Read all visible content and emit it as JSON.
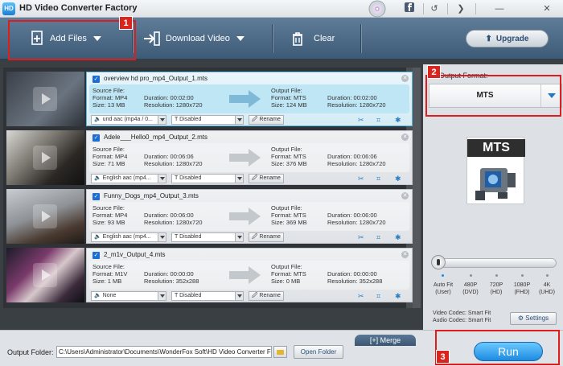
{
  "window": {
    "title": "HD Video Converter Factory",
    "logo_text": "HD"
  },
  "titlebar_icons": [
    "facebook-icon",
    "refresh-icon",
    "twitter-icon",
    "minimize-icon",
    "close-icon"
  ],
  "toolbar": {
    "add_files": "Add Files",
    "download_video": "Download Video",
    "clear": "Clear",
    "upgrade": "Upgrade"
  },
  "callouts": {
    "one": "1",
    "two": "2",
    "three": "3"
  },
  "labels": {
    "source_file": "Source File:",
    "output_file": "Output File:",
    "format": "Format:",
    "size": "Size:",
    "duration": "Duration:",
    "resolution": "Resolution:",
    "rename": "Rename"
  },
  "tasks": [
    {
      "name": "overview hd pro_mp4_Output_1.mts",
      "src": {
        "format": "MP4",
        "size": "13 MB",
        "duration": "00:02:00",
        "resolution": "1280x720"
      },
      "out": {
        "format": "MTS",
        "size": "124 MB",
        "duration": "00:02:00",
        "resolution": "1280x720"
      },
      "audio": "und aac (mp4a / 0...",
      "subtitle": "Disabled"
    },
    {
      "name": "Adele___Hello0_mp4_Output_2.mts",
      "src": {
        "format": "MP4",
        "size": "71 MB",
        "duration": "00:06:06",
        "resolution": "1280x720"
      },
      "out": {
        "format": "MTS",
        "size": "376 MB",
        "duration": "00:06:06",
        "resolution": "1280x720"
      },
      "audio": "English aac (mp4...",
      "subtitle": "Disabled"
    },
    {
      "name": "Funny_Dogs_mp4_Output_3.mts",
      "src": {
        "format": "MP4",
        "size": "93 MB",
        "duration": "00:06:00",
        "resolution": "1280x720"
      },
      "out": {
        "format": "MTS",
        "size": "369 MB",
        "duration": "00:06:00",
        "resolution": "1280x720"
      },
      "audio": "English aac (mp4...",
      "subtitle": "Disabled"
    },
    {
      "name": "2_m1v_Output_4.mts",
      "src": {
        "format": "M1V",
        "size": "1 MB",
        "duration": "00:00:00",
        "resolution": "352x288"
      },
      "out": {
        "format": "MTS",
        "size": "0 MB",
        "duration": "00:00:00",
        "resolution": "352x288"
      },
      "audio": "None",
      "subtitle": "Disabled"
    }
  ],
  "right_panel": {
    "output_format_label": "Output Format:",
    "output_format_value": "MTS",
    "preview_label": "MTS",
    "resolutions": [
      {
        "line1": "Auto Fit",
        "line2": "(User)"
      },
      {
        "line1": "480P",
        "line2": "(DVD)"
      },
      {
        "line1": "720P",
        "line2": "(HD)"
      },
      {
        "line1": "1080P",
        "line2": "(FHD)"
      },
      {
        "line1": "4K",
        "line2": "(UHD)"
      }
    ],
    "selected_resolution": "Auto Fit",
    "video_codec": "Video Codec: Smart Fit",
    "audio_codec": "Audio Codec: Smart Fit",
    "settings": "Settings"
  },
  "bottom": {
    "output_folder_label": "Output Folder:",
    "output_path": "C:\\Users\\Administrator\\Documents\\WonderFox Soft\\HD Video Converter Fac",
    "open_folder": "Open Folder",
    "merge": "Merge",
    "run": "Run"
  },
  "colors": {
    "accent": "#1d8be0",
    "callout": "#e01d1d",
    "toolbar": "#4a6886"
  }
}
